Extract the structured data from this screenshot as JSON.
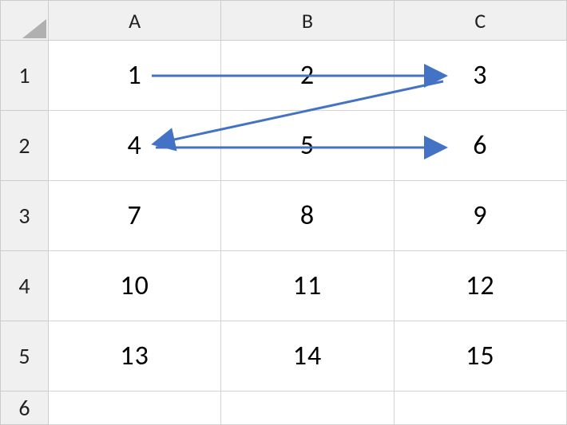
{
  "sheet": {
    "column_headers": [
      "A",
      "B",
      "C"
    ],
    "row_headers": [
      "1",
      "2",
      "3",
      "4",
      "5",
      "6"
    ],
    "rows": [
      {
        "A": "1",
        "B": "2",
        "C": "3"
      },
      {
        "A": "4",
        "B": "5",
        "C": "6"
      },
      {
        "A": "7",
        "B": "8",
        "C": "9"
      },
      {
        "A": "10",
        "B": "11",
        "C": "12"
      },
      {
        "A": "13",
        "B": "14",
        "C": "15"
      },
      {
        "A": "",
        "B": "",
        "C": ""
      }
    ]
  },
  "overlay": {
    "arrows": [
      {
        "from_cell": "A1",
        "to_cell": "C1",
        "color": "#4472c4"
      },
      {
        "from_cell": "C1",
        "to_cell": "A2",
        "color": "#4472c4"
      },
      {
        "from_cell": "A2",
        "to_cell": "C2",
        "color": "#4472c4"
      }
    ]
  }
}
